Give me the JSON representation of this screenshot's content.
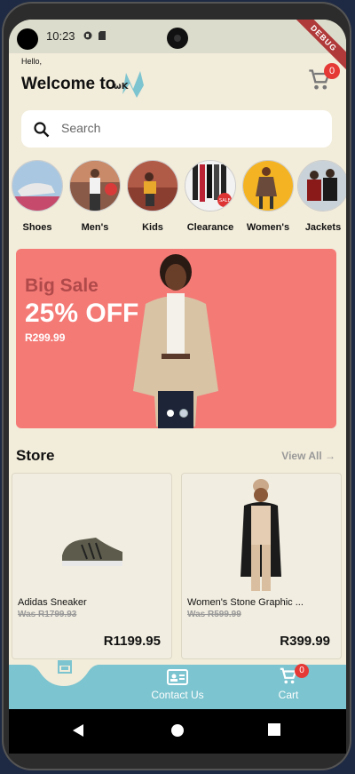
{
  "status": {
    "time": "10:23",
    "debug_label": "DEBUG"
  },
  "header": {
    "greeting": "Hello,",
    "welcome": "Welcome to",
    "cart_count": "0"
  },
  "search": {
    "placeholder": "Search"
  },
  "categories": [
    {
      "label": "Shoes"
    },
    {
      "label": "Men's"
    },
    {
      "label": "Kids"
    },
    {
      "label": "Clearance",
      "tag": "SALE"
    },
    {
      "label": "Women's"
    },
    {
      "label": "Jackets"
    }
  ],
  "banner": {
    "title": "Big Sale",
    "discount": "25% OFF",
    "price": "R299.99",
    "page_count": 2,
    "active_page": 1
  },
  "store": {
    "title": "Store",
    "view_all": "View All",
    "products": [
      {
        "name": "Adidas Sneaker",
        "was": "Was R1799.93",
        "price": "R1199.95"
      },
      {
        "name": "Women's Stone Graphic ...",
        "was": "Was R599.99",
        "price": "R399.99"
      }
    ]
  },
  "bottom_nav": {
    "items": [
      {
        "label": "",
        "icon": "store-icon"
      },
      {
        "label": "Contact Us",
        "icon": "contact-card-icon"
      },
      {
        "label": "Cart",
        "icon": "cart-icon"
      }
    ],
    "cart_count": "0"
  },
  "colors": {
    "background": "#f2ecda",
    "nav": "#7cc4cf",
    "accent": "#e53935",
    "banner": "#f47a76"
  }
}
